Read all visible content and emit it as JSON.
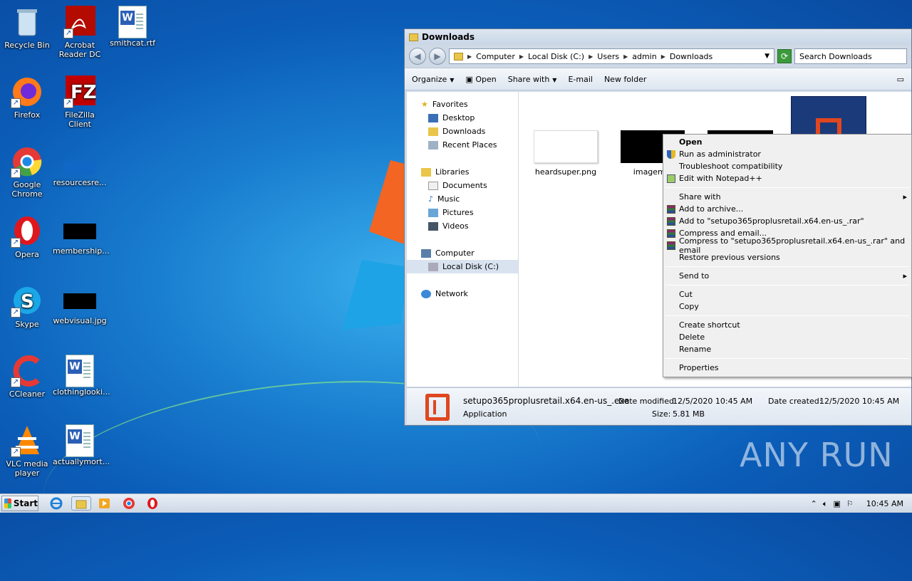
{
  "desktop": {
    "icons": [
      {
        "label": "Recycle Bin"
      },
      {
        "label": "Acrobat Reader DC"
      },
      {
        "label": "smithcat.rtf"
      },
      {
        "label": "Firefox"
      },
      {
        "label": "FileZilla Client"
      },
      {
        "label": "Google Chrome"
      },
      {
        "label": "resourcesre..."
      },
      {
        "label": "Opera"
      },
      {
        "label": "membership..."
      },
      {
        "label": "Skype"
      },
      {
        "label": "webvisual.jpg"
      },
      {
        "label": "CCleaner"
      },
      {
        "label": "clothinglooki..."
      },
      {
        "label": "VLC media player"
      },
      {
        "label": "actuallymort..."
      }
    ]
  },
  "window": {
    "title": "Downloads",
    "breadcrumb": [
      "Computer",
      "Local Disk (C:)",
      "Users",
      "admin",
      "Downloads"
    ],
    "search_placeholder": "Search Downloads",
    "toolbar": {
      "organize": "Organize",
      "open": "Open",
      "share_with": "Share with",
      "email": "E-mail",
      "new_folder": "New folder"
    },
    "nav": {
      "favorites": "Favorites",
      "desktop": "Desktop",
      "downloads": "Downloads",
      "recent": "Recent Places",
      "libraries": "Libraries",
      "documents": "Documents",
      "music": "Music",
      "pictures": "Pictures",
      "videos": "Videos",
      "computer": "Computer",
      "local_disk": "Local Disk (C:)",
      "network": "Network"
    },
    "files": [
      {
        "name": "heardsuper.png"
      },
      {
        "name": "imagemik"
      }
    ],
    "status": {
      "filename": "setupo365proplusretail.x64.en-us_.exe",
      "type": "Application",
      "date_modified_label": "Date modified:",
      "date_modified": "12/5/2020 10:45 AM",
      "size_label": "Size:",
      "size": "5.81 MB",
      "date_created_label": "Date created:",
      "date_created": "12/5/2020 10:45 AM"
    }
  },
  "context_menu": {
    "open": "Open",
    "run_admin": "Run as administrator",
    "troubleshoot": "Troubleshoot compatibility",
    "notepad": "Edit with Notepad++",
    "share_with": "Share with",
    "add_archive": "Add to archive...",
    "add_rar": "Add to \"setupo365proplusretail.x64.en-us_.rar\"",
    "compress_email": "Compress and email...",
    "compress_rar_email": "Compress to \"setupo365proplusretail.x64.en-us_.rar\" and email",
    "restore": "Restore previous versions",
    "send_to": "Send to",
    "cut": "Cut",
    "copy": "Copy",
    "create_shortcut": "Create shortcut",
    "delete": "Delete",
    "rename": "Rename",
    "properties": "Properties"
  },
  "taskbar": {
    "start": "Start",
    "clock": "10:45 AM"
  },
  "watermark": "ANY RUN"
}
